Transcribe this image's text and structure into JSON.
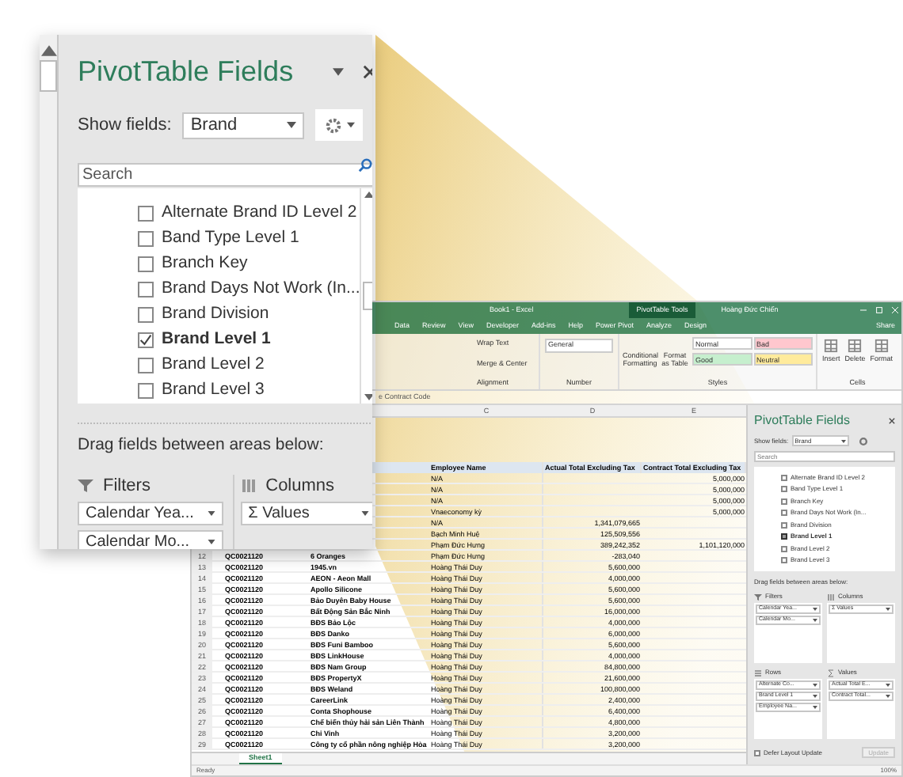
{
  "excel": {
    "title": "Book1 - Excel",
    "context_label": "PivotTable Tools",
    "user": "Hoàng Đức Chiến",
    "share": "Share",
    "tabs": [
      "Data",
      "Review",
      "View",
      "Developer",
      "Add-ins",
      "Help",
      "Power Pivot",
      "Analyze",
      "Design"
    ],
    "ribbon": {
      "wrap_text": "Wrap Text",
      "merge": "Merge & Center",
      "alignment_label": "Alignment",
      "number_format": "General",
      "number_label": "Number",
      "conditional": "Conditional Formatting",
      "format_table": "Format as Table",
      "styles_label": "Styles",
      "styles": [
        {
          "label": "Normal",
          "color": "#ffffff"
        },
        {
          "label": "Bad",
          "color": "#ffc7ce"
        },
        {
          "label": "Good",
          "color": "#c6efce"
        },
        {
          "label": "Neutral",
          "color": "#ffeb9c"
        }
      ],
      "cells": [
        "Insert",
        "Delete",
        "Format"
      ],
      "cells_label": "Cells"
    },
    "formula": "e Contract Code",
    "columns": [
      "C",
      "D",
      "E"
    ],
    "header": [
      "Employee Name",
      "Actual Total Excluding Tax",
      "Contract Total Excluding Tax"
    ],
    "rows": [
      {
        "employee": "N/A",
        "contract": "5,000,000"
      },
      {
        "employee": "N/A",
        "contract": "5,000,000"
      },
      {
        "employee": "N/A",
        "contract": "5,000,000"
      },
      {
        "employee": "Vnaeconomy kỳ",
        "contract": "5,000,000"
      },
      {
        "employee": "N/A",
        "actual": "1,341,079,665"
      },
      {
        "employee": "Bạch Minh Huệ",
        "actual": "125,509,556"
      },
      {
        "employee": "Phạm Đức Hưng",
        "actual": "389,242,352",
        "contract": "1,101,120,000"
      },
      {
        "num": "12",
        "code": "QC0021120",
        "brand": "6 Oranges",
        "employee": "Phạm Đức Hưng",
        "actual": "-283,040"
      },
      {
        "num": "13",
        "code": "QC0021120",
        "brand": "1945.vn",
        "employee": "Hoàng Thái Duy",
        "actual": "5,600,000"
      },
      {
        "num": "14",
        "code": "QC0021120",
        "brand": "AEON - Aeon Mall",
        "employee": "Hoàng Thái Duy",
        "actual": "4,000,000"
      },
      {
        "num": "15",
        "code": "QC0021120",
        "brand": "Apollo Silicone",
        "employee": "Hoàng Thái Duy",
        "actual": "5,600,000"
      },
      {
        "num": "16",
        "code": "QC0021120",
        "brand": "Bảo Duyên Baby House",
        "employee": "Hoàng Thái Duy",
        "actual": "5,600,000"
      },
      {
        "num": "17",
        "code": "QC0021120",
        "brand": "Bất Động Sản Bắc Ninh",
        "employee": "Hoàng Thái Duy",
        "actual": "16,000,000"
      },
      {
        "num": "18",
        "code": "QC0021120",
        "brand": "BĐS Bảo Lộc",
        "employee": "Hoàng Thái Duy",
        "actual": "4,000,000"
      },
      {
        "num": "19",
        "code": "QC0021120",
        "brand": "BĐS Danko",
        "employee": "Hoàng Thái Duy",
        "actual": "6,000,000"
      },
      {
        "num": "20",
        "code": "QC0021120",
        "brand": "BĐS Funi Bamboo",
        "employee": "Hoàng Thái Duy",
        "actual": "5,600,000"
      },
      {
        "num": "21",
        "code": "QC0021120",
        "brand": "BĐS LinkHouse",
        "employee": "Hoàng Thái Duy",
        "actual": "4,000,000"
      },
      {
        "num": "22",
        "code": "QC0021120",
        "brand": "BĐS Nam Group",
        "employee": "Hoàng Thái Duy",
        "actual": "84,800,000"
      },
      {
        "num": "23",
        "code": "QC0021120",
        "brand": "BĐS PropertyX",
        "employee": "Hoàng Thái Duy",
        "actual": "21,600,000"
      },
      {
        "num": "24",
        "code": "QC0021120",
        "brand": "BĐS Weland",
        "employee": "Hoàng Thái Duy",
        "actual": "100,800,000"
      },
      {
        "num": "25",
        "code": "QC0021120",
        "brand": "CareerLink",
        "employee": "Hoàng Thái Duy",
        "actual": "2,400,000"
      },
      {
        "num": "26",
        "code": "QC0021120",
        "brand": "Conta Shophouse",
        "employee": "Hoàng Thái Duy",
        "actual": "6,400,000"
      },
      {
        "num": "27",
        "code": "QC0021120",
        "brand": "Chế biến thủy hải sản Liên Thành",
        "employee": "Hoàng Thái Duy",
        "actual": "4,800,000"
      },
      {
        "num": "28",
        "code": "QC0021120",
        "brand": "Chi Vinh",
        "employee": "Hoàng Thái Duy",
        "actual": "3,200,000"
      },
      {
        "num": "29",
        "code": "QC0021120",
        "brand": "Công ty cổ phần nông nghiệp Hòa",
        "employee": "Hoàng Thái Duy",
        "actual": "3,200,000"
      }
    ],
    "sheet_tab": "Sheet1",
    "status": "Ready",
    "zoom_level": "100%"
  },
  "callout": {
    "title": "PivotTable Fields",
    "show_fields_label": "Show fields:",
    "show_fields_value": "Brand",
    "search_placeholder": "Search",
    "fields": [
      {
        "label": "Alternate Brand ID Level 2",
        "checked": false
      },
      {
        "label": "Band Type Level 1",
        "checked": false
      },
      {
        "label": "Branch Key",
        "checked": false
      },
      {
        "label": "Brand Days Not Work (In...",
        "checked": false
      },
      {
        "label": "Brand Division",
        "checked": false
      },
      {
        "label": "Brand Level 1",
        "checked": true
      },
      {
        "label": "Brand Level 2",
        "checked": false
      },
      {
        "label": "Brand Level 3",
        "checked": false
      }
    ],
    "drag_hint": "Drag fields between areas below:",
    "areas": [
      {
        "label": "Filters",
        "kind": "filter",
        "items": [
          "Calendar Yea...",
          "Calendar Mo..."
        ]
      },
      {
        "label": "Columns",
        "kind": "columns",
        "items": [
          "Σ Values"
        ]
      }
    ]
  },
  "pane": {
    "title": "PivotTable Fields",
    "show_fields_label": "Show fields:",
    "show_fields_value": "Brand",
    "search_placeholder": "Search",
    "fields": [
      {
        "label": "Alternate Brand ID Level 2",
        "checked": false
      },
      {
        "label": "Band Type Level 1",
        "checked": false
      },
      {
        "label": "Branch Key",
        "checked": false
      },
      {
        "label": "Brand Days Not Work (In...",
        "checked": false
      },
      {
        "label": "Brand Division",
        "checked": false
      },
      {
        "label": "Brand Level 1",
        "checked": true
      },
      {
        "label": "Brand Level 2",
        "checked": false
      },
      {
        "label": "Brand Level 3",
        "checked": false
      }
    ],
    "drag_hint": "Drag fields between areas below:",
    "areas": [
      {
        "label": "Filters",
        "kind": "filter",
        "items": [
          "Calendar Yea...",
          "Calendar Mo..."
        ]
      },
      {
        "label": "Columns",
        "kind": "columns",
        "items": [
          "Σ Values"
        ]
      },
      {
        "label": "Rows",
        "kind": "rows",
        "items": [
          "Alternate Co...",
          "Brand Level 1",
          "Employee Na..."
        ]
      },
      {
        "label": "Values",
        "kind": "values",
        "items": [
          "Actual Total E...",
          "Contract Total..."
        ]
      }
    ],
    "defer": {
      "label": "Defer Layout Update",
      "checked": false
    },
    "update": "Update"
  }
}
